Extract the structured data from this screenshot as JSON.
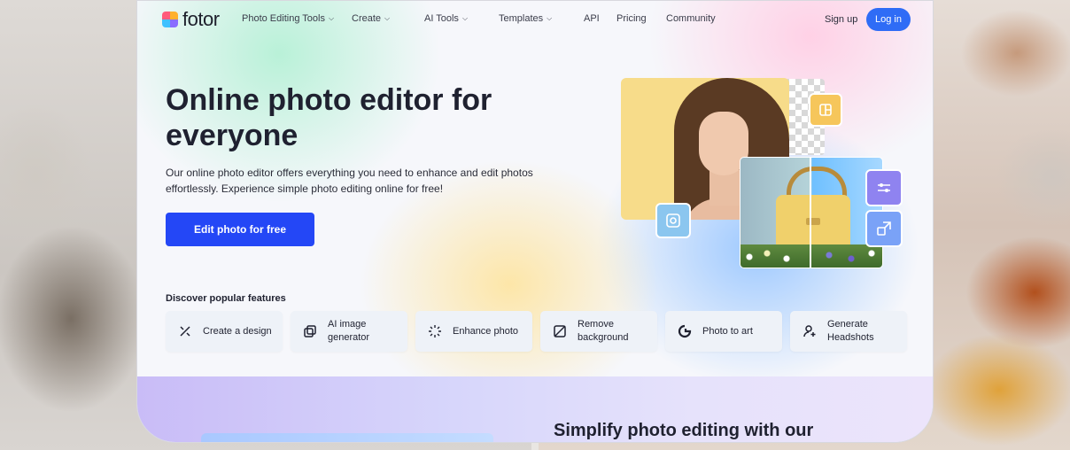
{
  "brand": {
    "name": "fotor",
    "logo_colors": [
      "#ff5a7a",
      "#ffb02e",
      "#3fc1ff",
      "#8a6cff"
    ]
  },
  "nav": {
    "items": [
      {
        "label": "Photo Editing Tools",
        "dropdown": true
      },
      {
        "label": "Create",
        "dropdown": true
      },
      {
        "label": "AI Tools",
        "dropdown": true
      },
      {
        "label": "Templates",
        "dropdown": true
      },
      {
        "label": "API",
        "dropdown": false
      },
      {
        "label": "Pricing",
        "dropdown": false
      },
      {
        "label": "Community",
        "dropdown": false
      }
    ],
    "signup": "Sign up",
    "login": "Log in"
  },
  "hero": {
    "title": "Online photo editor for everyone",
    "description": "Our online photo editor offers everything you need to enhance and edit photos effortlessly. Experience simple photo editing online for free!",
    "cta": "Edit photo for free"
  },
  "features": {
    "heading": "Discover popular features",
    "items": [
      {
        "label": "Create a design",
        "icon": "design-icon"
      },
      {
        "label": "AI image generator",
        "icon": "ai-image-icon"
      },
      {
        "label": "Enhance photo",
        "icon": "enhance-icon"
      },
      {
        "label": "Remove background",
        "icon": "remove-bg-icon"
      },
      {
        "label": "Photo to art",
        "icon": "art-icon"
      },
      {
        "label": "Generate Headshots",
        "icon": "headshot-icon"
      }
    ]
  },
  "section2": {
    "title": "Simplify photo editing with our"
  },
  "colors": {
    "accent": "#2447f6",
    "login": "#2f6cf6"
  }
}
